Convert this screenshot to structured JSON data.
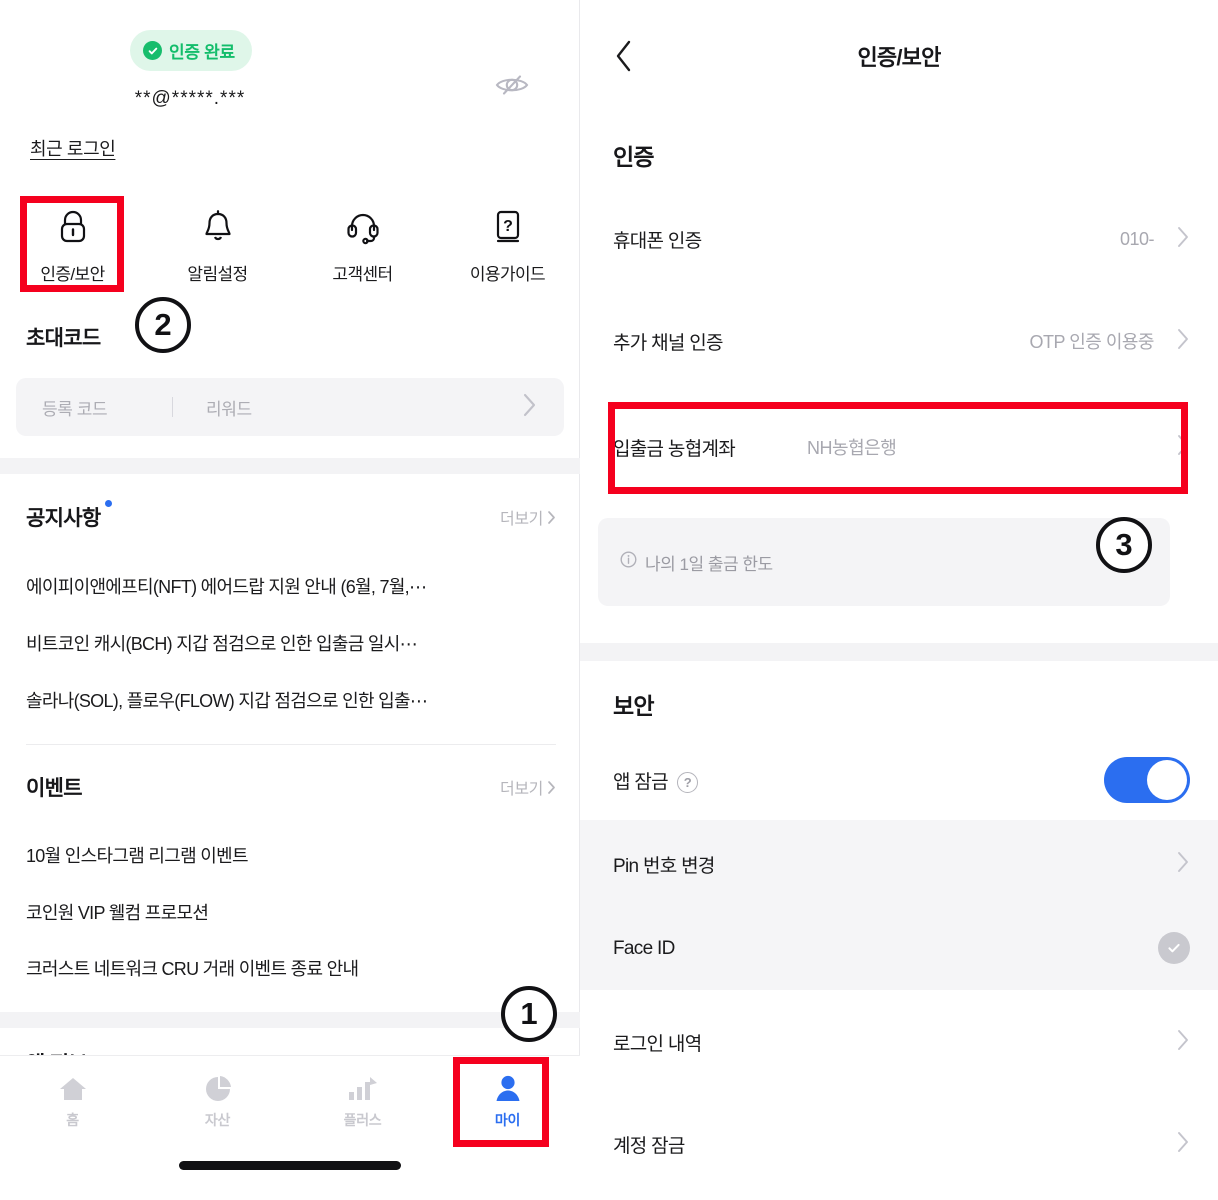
{
  "left": {
    "verify_badge": "인증 완료",
    "masked_email": "**@*****.***",
    "recent_login": "최근 로그인",
    "quick_menu": [
      {
        "label": "인증/보안",
        "icon": "lock-icon"
      },
      {
        "label": "알림설정",
        "icon": "bell-icon"
      },
      {
        "label": "고객센터",
        "icon": "headset-icon"
      },
      {
        "label": "이용가이드",
        "icon": "guide-book-icon"
      }
    ],
    "invite": {
      "title": "초대코드",
      "code_placeholder": "등록 코드",
      "reward_placeholder": "리워드"
    },
    "notice": {
      "title": "공지사항",
      "more": "더보기",
      "items": [
        "에이피이앤에프티(NFT) 에어드랍 지원 안내 (6월, 7월,⋯",
        "비트코인 캐시(BCH) 지갑 점검으로 인한 입출금 일시⋯",
        "솔라나(SOL), 플로우(FLOW) 지갑 점검으로 인한 입출⋯"
      ]
    },
    "event": {
      "title": "이벤트",
      "more": "더보기",
      "items": [
        "10월 인스타그램 리그램 이벤트",
        "코인원 VIP 웰컴 프로모션",
        "크러스트 네트워크 CRU 거래 이벤트 종료 안내"
      ]
    },
    "app_info_title": "앱 정보",
    "tabs": [
      {
        "label": "홈",
        "icon": "home-icon",
        "active": false
      },
      {
        "label": "자산",
        "icon": "pie-chart-icon",
        "active": false
      },
      {
        "label": "플러스",
        "icon": "bar-chart-up-icon",
        "active": false
      },
      {
        "label": "마이",
        "icon": "person-icon",
        "active": true
      }
    ]
  },
  "right": {
    "title": "인증/보안",
    "back_icon": "chevron-left-icon",
    "auth": {
      "title": "인증",
      "rows": [
        {
          "label": "휴대폰 인증",
          "value": "010-"
        },
        {
          "label": "추가 채널 인증",
          "value": "OTP 인증 이용중"
        },
        {
          "label": "입출금 농협계좌",
          "value": "NH농협은행"
        }
      ],
      "limit_notice": "나의 1일 출금 한도",
      "limit_icon": "info-icon"
    },
    "security": {
      "title": "보안",
      "app_lock_label": "앱 잠금",
      "app_lock_help_icon": "question-circle-icon",
      "app_lock_on": true,
      "rows": [
        {
          "label": "Pin 번호 변경",
          "type": "chevron"
        },
        {
          "label": "Face ID",
          "type": "check"
        },
        {
          "label": "로그인 내역",
          "type": "chevron"
        },
        {
          "label": "계정 잠금",
          "type": "chevron"
        }
      ]
    }
  },
  "annotations": {
    "circles": [
      "1",
      "2",
      "3"
    ],
    "highlight_color": "#f5001e"
  },
  "colors": {
    "accent_blue": "#2b6ef0",
    "badge_green": "#13bd6b",
    "badge_green_bg": "#dff6e9",
    "highlight_red": "#f5001e",
    "muted_gray": "#a8a8b0",
    "panel_gray": "#f4f4f6"
  }
}
